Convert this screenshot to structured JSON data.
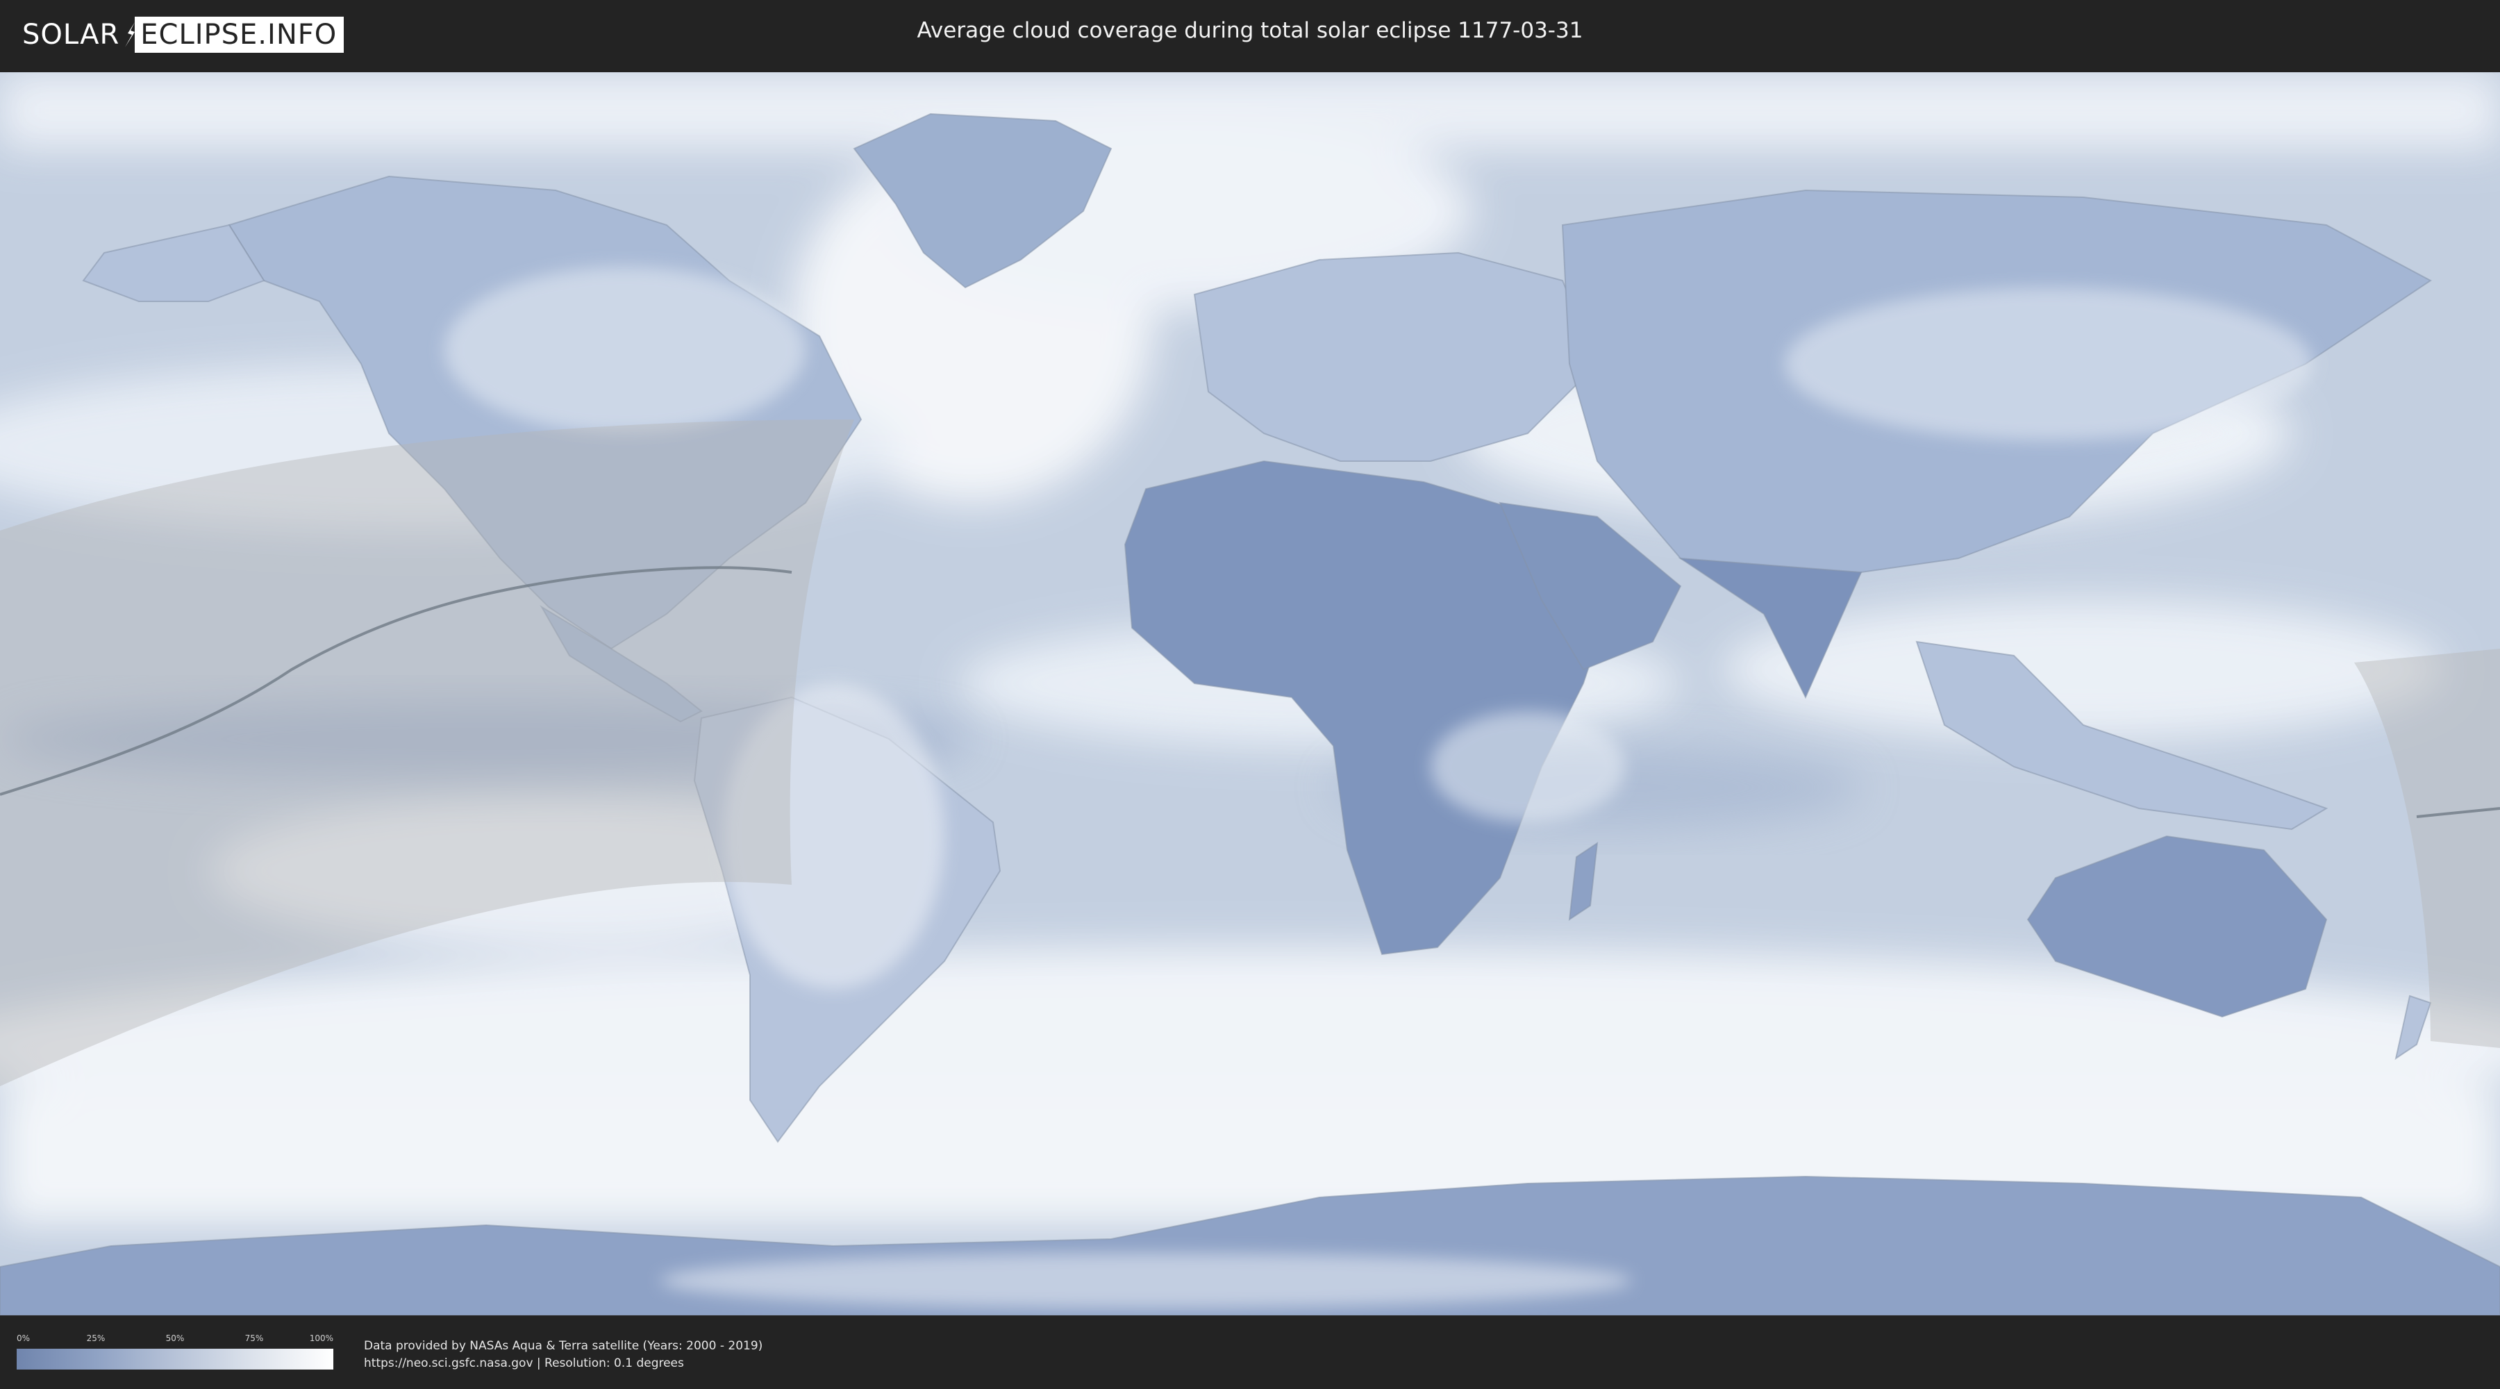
{
  "header": {
    "logo": {
      "left_text": "SOLAR",
      "right_text": "ECLIPSE.INFO"
    },
    "title": "Average cloud coverage during total solar eclipse 1177-03-31"
  },
  "map": {
    "ocean_color": "#c3cfe0",
    "land_cloudy_color": "#dde5ef",
    "land_clear_color": "#6f86b0",
    "cloud_color": "#f4f7fb",
    "eclipse_shadow_color": "#b9b9b9",
    "central_line_color": "#6f7a86"
  },
  "legend": {
    "ticks": [
      "0%",
      "25%",
      "50%",
      "75%",
      "100%"
    ],
    "gradient": [
      "#7085ad",
      "#8fa2c4",
      "#b7c3d8",
      "#dde3ec",
      "#ffffff"
    ]
  },
  "attribution": {
    "line1": "Data provided by NASAs Aqua & Terra satellite (Years: 2000 - 2019)",
    "line2": "https://neo.sci.gsfc.nasa.gov | Resolution: 0.1 degrees"
  }
}
